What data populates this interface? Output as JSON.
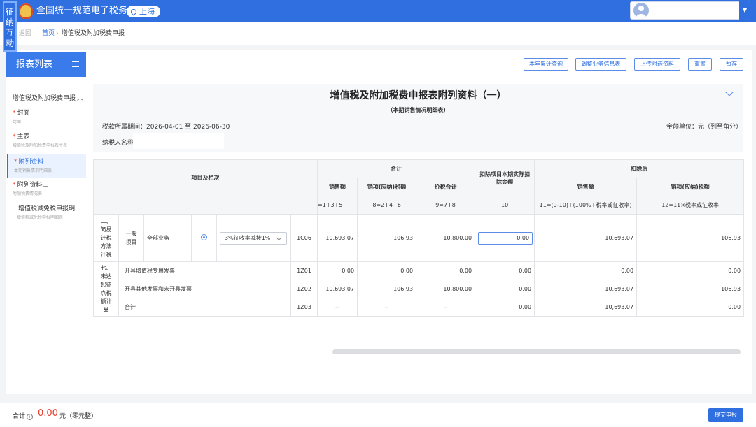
{
  "header": {
    "site_title": "全国统一规范电子税务局",
    "city": "上海",
    "side_tab": "征纳互动",
    "brand_color": "#2f6fe0"
  },
  "breadcrumb": {
    "back": "返回",
    "home": "首页",
    "separator": "›",
    "current": "增值税及附加税费申报"
  },
  "sidebar": {
    "title": "报表列表",
    "group": "增值税及附加税费申报",
    "items": [
      {
        "title": "封面",
        "subtitle": "封面",
        "required": "*"
      },
      {
        "title": "主表",
        "subtitle": "增值税及附加税费申报表主表",
        "required": "*"
      },
      {
        "title": "附列资料一",
        "subtitle": "本期销售情况明细表",
        "required": "*"
      },
      {
        "title": "附列资料三",
        "subtitle": "附加税费情况表",
        "required": "*"
      },
      {
        "title": "增值税减免税申报明...",
        "subtitle": "增值税减免税申报明细表",
        "required": ""
      }
    ]
  },
  "toolbar": {
    "year_query": "本年累计查询",
    "adjust_info": "调整业务信息表",
    "upload": "上传附送资料",
    "reset": "重置",
    "save": "暂存"
  },
  "form": {
    "title": "增值税及附加税费申报表附列资料（一）",
    "subtitle": "（本期销售情况明细表）",
    "period": "税款所属期间：2026-04-01 至 2026-06-30",
    "unit": "金额单位：元（列至角分）",
    "payer_label": "纳税人名称："
  },
  "table": {
    "header_items": "项目及栏次",
    "header_total": "合计",
    "header_deduct": "扣除项目本期实际扣除金额",
    "header_after": "扣除后",
    "col_sales": "销售额",
    "col_tax": "销项(应纳)税额",
    "col_price_tax": "价税合计",
    "col_sales2": "销售额",
    "col_tax2": "销项(应纳)税额",
    "f_sales": "=1+3+5",
    "f_tax": "8=2+4+6",
    "f_price": "9=7+8",
    "f_deduct": "10",
    "f_after_sales": "11=(9-10)÷(100%+税率或征收率)",
    "f_after_tax": "12=11×税率或征收率",
    "simple": {
      "category": "二、简易计税方法计税",
      "sub": "一般项目",
      "item": "全部业务",
      "rate": "3%征收率减按1%",
      "code": "1C06",
      "sales": "10,693.07",
      "tax": "106.93",
      "price_tax": "10,800.00",
      "deduct": "0.00",
      "after_sales": "10,693.07",
      "after_tax": "106.93"
    },
    "exempt_category": "七、未达起征点税额计算",
    "exempt_rows": [
      {
        "label": "开具增值税专用发票",
        "code": "1Z01",
        "sales": "0.00",
        "tax": "0.00",
        "price_tax": "0.00",
        "deduct": "0.00",
        "after_sales": "0.00",
        "after_tax": "0.00"
      },
      {
        "label": "开具其他发票和未开具发票",
        "code": "1Z02",
        "sales": "10,693.07",
        "tax": "106.93",
        "price_tax": "10,800.00",
        "deduct": "0.00",
        "after_sales": "10,693.07",
        "after_tax": "106.93"
      },
      {
        "label": "合计",
        "code": "1Z03",
        "sales": "--",
        "tax": "--",
        "price_tax": "--",
        "deduct": "0.00",
        "after_sales": "10,693.07",
        "after_tax": "0.00"
      }
    ]
  },
  "footer": {
    "total_label": "合计",
    "info_glyph": "i",
    "total_value": "0.00",
    "total_unit": "元（零元整）",
    "submit": "提交申报"
  }
}
